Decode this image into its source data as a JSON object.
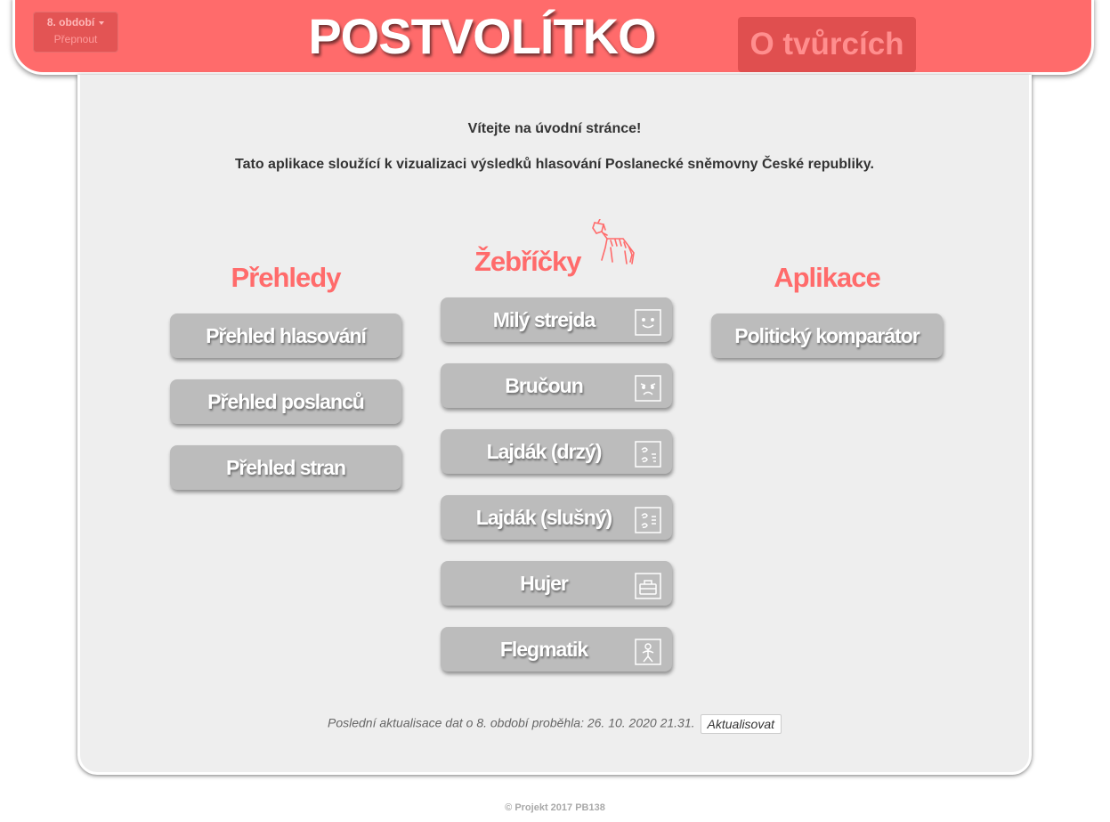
{
  "header": {
    "term_label": "8. období",
    "term_switch_label": "Přepnout",
    "app_title": "POSTVOLÍTKO",
    "creators_label": "O tvůrcích"
  },
  "main": {
    "welcome": "Vítejte na úvodní stránce!",
    "intro": "Tato aplikace sloužící k vizualizaci výsledků hlasování Poslanecké sněmovny České republiky.",
    "overviews": {
      "title": "Přehledy",
      "items": [
        "Přehled hlasování",
        "Přehled poslanců",
        "Přehled stran"
      ]
    },
    "rankings": {
      "title": "Žebříčky",
      "title_icon": "zebra-icon",
      "items": [
        {
          "label": "Milý strejda",
          "icon": "smile-face-icon"
        },
        {
          "label": "Bručoun",
          "icon": "grumpy-face-icon"
        },
        {
          "label": "Lajdák (drzý)",
          "icon": "sloppy-rude-icon"
        },
        {
          "label": "Lajdák (slušný)",
          "icon": "sloppy-polite-icon"
        },
        {
          "label": "Hujer",
          "icon": "briefcase-icon"
        },
        {
          "label": "Flegmatik",
          "icon": "phlegmatic-figure-icon"
        }
      ]
    },
    "apps": {
      "title": "Aplikace",
      "items": [
        "Politický komparátor"
      ]
    },
    "update_note": "Poslední aktualisace dat o 8. období proběhla: 26. 10. 2020 21.31.",
    "update_button": "Aktualisovat"
  },
  "footer": {
    "copyright": "© Projekt 2017 PB138"
  },
  "colors": {
    "accent": "#ff6b6b",
    "accent_dark": "#e04f4f",
    "panel_bg": "#eeeeee",
    "button_bg": "#bcbcbc"
  }
}
